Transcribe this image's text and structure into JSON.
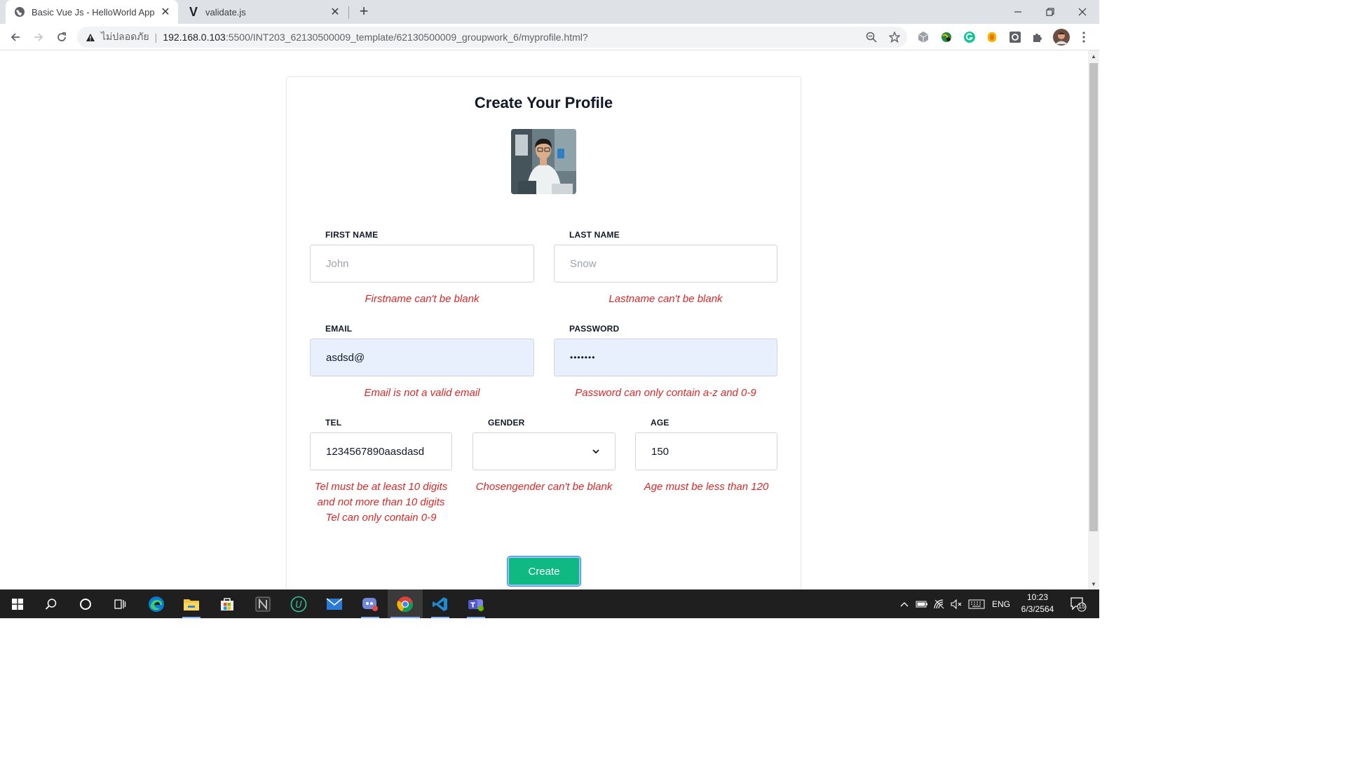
{
  "browser": {
    "tabs": [
      {
        "title": "Basic Vue Js - HelloWorld App",
        "active": true
      },
      {
        "title": "validate.js",
        "active": false
      }
    ],
    "address": {
      "security_label": "ไม่ปลอดภัย",
      "host": "192.168.0.103",
      "path": ":5500/INT203_62130500009_template/62130500009_groupwork_6/myprofile.html?"
    }
  },
  "form": {
    "title": "Create Your Profile",
    "first_name": {
      "label": "FIRST NAME",
      "placeholder": "John",
      "value": "",
      "error": "Firstname can't be blank"
    },
    "last_name": {
      "label": "LAST NAME",
      "placeholder": "Snow",
      "value": "",
      "error": "Lastname can't be blank"
    },
    "email": {
      "label": "EMAIL",
      "value": "asdsd@",
      "error": "Email is not a valid email"
    },
    "password": {
      "label": "PASSWORD",
      "value": "•••••••",
      "error": "Password can only contain a-z and 0-9"
    },
    "tel": {
      "label": "TEL",
      "value": "1234567890aasdasd",
      "errors": [
        "Tel must be at least 10 digits",
        "and not more than 10 digits",
        "Tel can only contain 0-9"
      ]
    },
    "gender": {
      "label": "GENDER",
      "value": "",
      "error": "Chosengender can't be blank"
    },
    "age": {
      "label": "AGE",
      "value": "150",
      "error": "Age must be less than 120"
    },
    "submit_label": "Create"
  },
  "taskbar": {
    "language": "ENG",
    "time": "10:23",
    "date": "6/3/2564",
    "notifications": "15"
  },
  "colors": {
    "accent_button": "#10b981",
    "error_text": "#dc2626",
    "autofill_bg": "#e8f0fe"
  }
}
